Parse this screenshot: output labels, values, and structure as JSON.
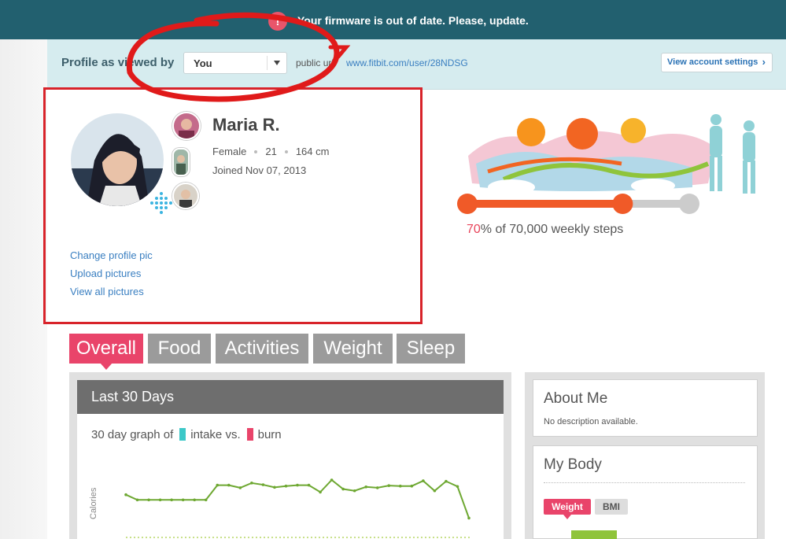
{
  "banner": {
    "alert_icon": "!",
    "message": "Your firmware is out of date. Please, update."
  },
  "profile_bar": {
    "label": "Profile as viewed by",
    "viewer_select_value": "You",
    "public_label": "public url:",
    "public_url": "www.fitbit.com/user/28NDSG",
    "settings_button": "View account settings",
    "settings_chevron": "›"
  },
  "profile": {
    "name": "Maria R.",
    "gender": "Female",
    "age": "21",
    "height": "164 cm",
    "joined": "Joined Nov 07, 2013",
    "links": [
      "Change profile pic",
      "Upload pictures",
      "View all pictures"
    ]
  },
  "steps": {
    "percent": 70,
    "percent_label": "70",
    "rest_label": "% of 70,000 weekly steps"
  },
  "tabs": [
    {
      "label": "Overall",
      "active": true
    },
    {
      "label": "Food",
      "active": false
    },
    {
      "label": "Activities",
      "active": false
    },
    {
      "label": "Weight",
      "active": false
    },
    {
      "label": "Sleep",
      "active": false
    }
  ],
  "graph_panel": {
    "title": "Last 30 Days",
    "legend_prefix": "30 day graph of",
    "legend_intake": "intake vs.",
    "legend_burn": "burn",
    "y_axis_label": "Calories",
    "intake_color": "#3cc8c8",
    "burn_color": "#e9446a",
    "line_color": "#6ea832"
  },
  "chart_data": {
    "type": "line",
    "series": [
      {
        "name": "burn",
        "values": [
          66,
          54,
          54,
          54,
          54,
          54,
          54,
          54,
          88,
          88,
          82,
          93,
          89,
          83,
          86,
          88,
          88,
          72,
          100,
          79,
          75,
          84,
          82,
          87,
          86,
          86,
          98,
          75,
          97,
          85,
          12
        ]
      }
    ]
  },
  "about_me": {
    "title": "About Me",
    "text": "No description available."
  },
  "my_body": {
    "title": "My Body",
    "tabs": [
      "Weight",
      "BMI"
    ],
    "active_tab": "Weight"
  },
  "colors": {
    "banner": "#22606f",
    "accent": "#e9446a",
    "tab_inactive": "#9b9b9b",
    "annotation": "#d8232a"
  }
}
